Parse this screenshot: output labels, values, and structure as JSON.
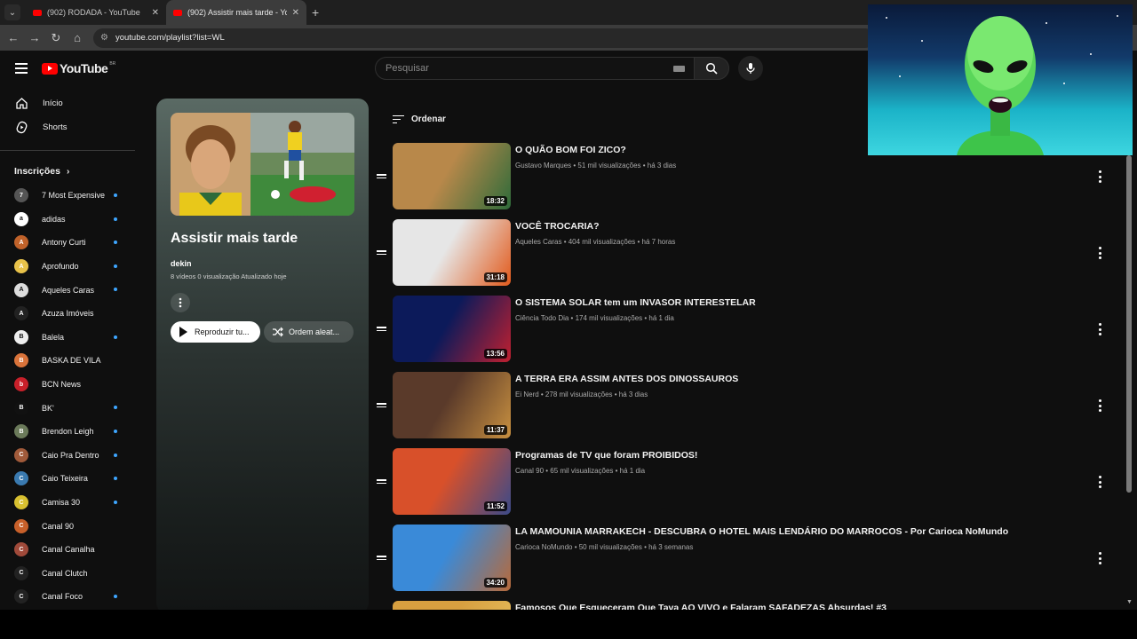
{
  "browser": {
    "tabs": [
      {
        "title": "(902) RODADA - YouTube",
        "active": false
      },
      {
        "title": "(902) Assistir mais tarde - YouTube",
        "active": true
      }
    ],
    "url": "youtube.com/playlist?list=WL"
  },
  "header": {
    "logo_text": "YouTube",
    "country": "BR",
    "search_placeholder": "Pesquisar"
  },
  "sidebar": {
    "nav": [
      {
        "label": "Início",
        "icon": "home-icon"
      },
      {
        "label": "Shorts",
        "icon": "shorts-icon"
      }
    ],
    "subs_heading": "Inscrições",
    "subscriptions": [
      {
        "name": "7 Most Expensive",
        "initial": "7",
        "color": "#555555",
        "dot": true
      },
      {
        "name": "adidas",
        "initial": "a",
        "color": "#ffffff",
        "dot": true
      },
      {
        "name": "Antony Curti",
        "initial": "A",
        "color": "#c0622a",
        "dot": true
      },
      {
        "name": "Aprofundo",
        "initial": "A",
        "color": "#e8c24a",
        "dot": true
      },
      {
        "name": "Aqueles Caras",
        "initial": "A",
        "color": "#dddddd",
        "dot": true
      },
      {
        "name": "Azuza Imóveis",
        "initial": "A",
        "color": "#222222",
        "dot": false
      },
      {
        "name": "Balela",
        "initial": "B",
        "color": "#eeeeee",
        "dot": true
      },
      {
        "name": "BASKA DE VILA",
        "initial": "B",
        "color": "#d9733a",
        "dot": false
      },
      {
        "name": "BCN News",
        "initial": "b",
        "color": "#c8202a",
        "dot": false
      },
      {
        "name": "BK'",
        "initial": "B",
        "color": "#111111",
        "dot": true
      },
      {
        "name": "Brendon Leigh",
        "initial": "B",
        "color": "#6b7a5a",
        "dot": true
      },
      {
        "name": "Caio Pra Dentro",
        "initial": "C",
        "color": "#a05a3a",
        "dot": true
      },
      {
        "name": "Caio Teixeira",
        "initial": "C",
        "color": "#3a7ab0",
        "dot": true
      },
      {
        "name": "Camisa 30",
        "initial": "C",
        "color": "#d8c030",
        "dot": true
      },
      {
        "name": "Canal 90",
        "initial": "C",
        "color": "#c8602a",
        "dot": false
      },
      {
        "name": "Canal Canalha",
        "initial": "C",
        "color": "#a04a3a",
        "dot": false
      },
      {
        "name": "Canal Clutch",
        "initial": "C",
        "color": "#222222",
        "dot": false
      },
      {
        "name": "Canal Foco",
        "initial": "C",
        "color": "#222222",
        "dot": true
      }
    ]
  },
  "playlist": {
    "title": "Assistir mais tarde",
    "owner": "dekin",
    "meta": "8 vídeos   0 visualização   Atualizado hoje",
    "play_label": "Reproduzir tu...",
    "shuffle_label": "Ordem aleat..."
  },
  "list": {
    "sort_label": "Ordenar",
    "videos": [
      {
        "title": "O QUÃO BOM FOI ZICO?",
        "meta": "Gustavo Marques • 51 mil visualizações • há 3 dias",
        "duration": "18:32",
        "thumb": [
          "#b8884a",
          "#2e6b3a"
        ]
      },
      {
        "title": "VOCÊ TROCARIA?",
        "meta": "Aqueles Caras • 404 mil visualizações • há 7 horas",
        "duration": "31:18",
        "thumb": [
          "#e6e6e6",
          "#e25a1c"
        ]
      },
      {
        "title": "O SISTEMA SOLAR tem um INVASOR INTERESTELAR",
        "meta": "Ciência Todo Dia • 174 mil visualizações • há 1 dia",
        "duration": "13:56",
        "thumb": [
          "#0c1a5a",
          "#c02030"
        ]
      },
      {
        "title": "A TERRA ERA ASSIM ANTES DOS DINOSSAUROS",
        "meta": "Ei Nerd • 278 mil visualizações • há 3 dias",
        "duration": "11:37",
        "thumb": [
          "#5a3a2a",
          "#c89040"
        ]
      },
      {
        "title": "Programas de TV que foram PROIBIDOS!",
        "meta": "Canal 90 • 65 mil visualizações • há 1 dia",
        "duration": "11:52",
        "thumb": [
          "#d8502a",
          "#3a4a8a"
        ]
      },
      {
        "title": "LA MAMOUNIA MARRAKECH - DESCUBRA O HOTEL MAIS LENDÁRIO DO MARROCOS - Por Carioca NoMundo",
        "meta": "Carioca NoMundo • 50 mil visualizações • há 3 semanas",
        "duration": "34:20",
        "thumb": [
          "#3a8ad8",
          "#b86a3a"
        ]
      },
      {
        "title": "Famosos Que Esqueceram Que Tava AO VIVO e Falaram SAFADEZAS Absurdas! #3",
        "meta": "",
        "duration": "",
        "thumb": [
          "#d8a040",
          "#e6c060"
        ]
      }
    ]
  }
}
